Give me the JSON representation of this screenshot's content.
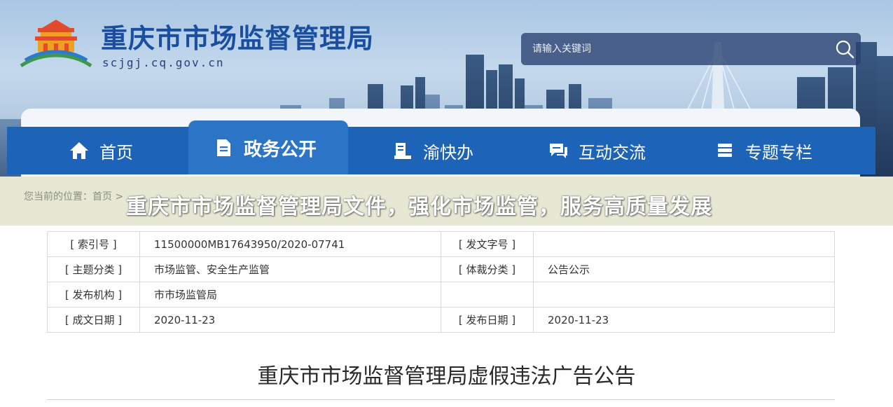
{
  "header": {
    "title": "重庆市市场监督管理局",
    "domain": "scjgj.cq.gov.cn",
    "logo_icon": "tiananmen-logo-icon"
  },
  "search": {
    "placeholder": "请输入关键词",
    "icon": "search-icon"
  },
  "nav": {
    "items": [
      {
        "label": "首页",
        "icon": "home-icon",
        "active": false
      },
      {
        "label": "政务公开",
        "icon": "document-icon",
        "active": true
      },
      {
        "label": "渝快办",
        "icon": "service-icon",
        "active": false
      },
      {
        "label": "互动交流",
        "icon": "chat-icon",
        "active": false
      },
      {
        "label": "专题专栏",
        "icon": "stack-icon",
        "active": false
      }
    ]
  },
  "breadcrumb": {
    "prefix": "您当前的位置：",
    "home": "首页",
    "separator": " > "
  },
  "headline_banner": "重庆市市场监督管理局文件，强化市场监管，服务高质量发展",
  "meta": {
    "rows": [
      {
        "k1": "[ 索引号 ]",
        "v1": "11500000MB17643950/2020-07741",
        "k2": "[ 发文字号 ]",
        "v2": ""
      },
      {
        "k1": "[ 主题分类 ]",
        "v1": "市场监管、安全生产监管",
        "k2": "[ 体裁分类 ]",
        "v2": "公告公示"
      },
      {
        "k1": "[ 发布机构 ]",
        "v1": "市市场监管局",
        "k2": "",
        "v2": ""
      },
      {
        "k1": "[ 成文日期 ]",
        "v1": "2020-11-23",
        "k2": "[ 发布日期 ]",
        "v2": "2020-11-23"
      }
    ]
  },
  "document": {
    "title": "重庆市市场监督管理局虚假违法广告公告"
  },
  "colors": {
    "brand_blue": "#1d63b8",
    "nav_active": "#2b74c6",
    "title_blue": "#1a4fa0",
    "banner_bg": "#e6e8d4"
  }
}
